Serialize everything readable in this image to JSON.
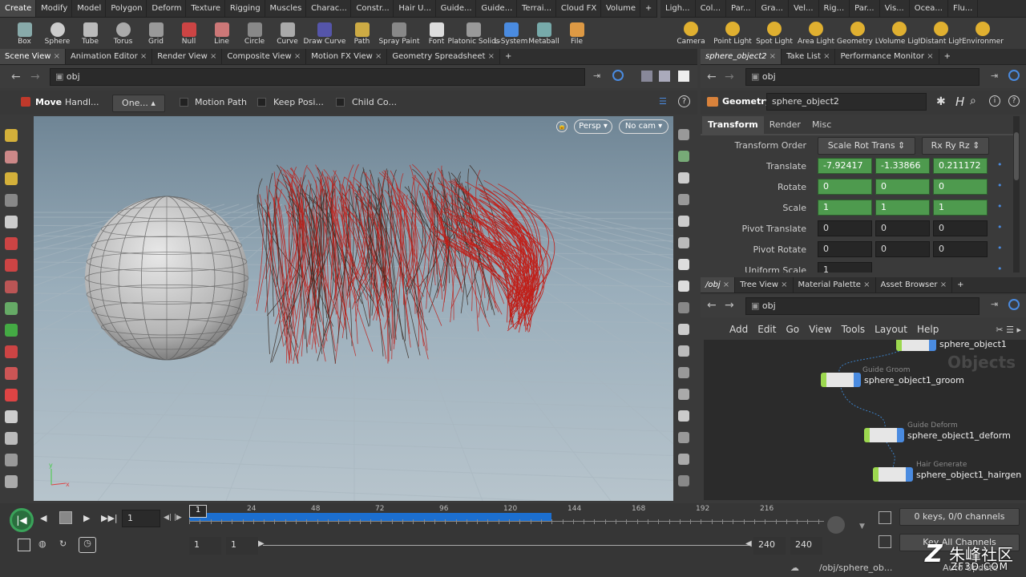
{
  "top_tabs": [
    "Create",
    "Modify",
    "Model",
    "Polygon",
    "Deform",
    "Texture",
    "Rigging",
    "Muscles",
    "Charac...",
    "Constr...",
    "Hair U...",
    "Guide...",
    "Guide...",
    "Terrai...",
    "Cloud FX",
    "Volume"
  ],
  "top_tabs_right": [
    "Ligh...",
    "Col...",
    "Par...",
    "Gra...",
    "Vel...",
    "Rig...",
    "Par...",
    "Vis...",
    "Ocea...",
    "Flu..."
  ],
  "shelf_tools": [
    "Box",
    "Sphere",
    "Tube",
    "Torus",
    "Grid",
    "Null",
    "Line",
    "Circle",
    "Curve",
    "Draw Curve",
    "Path",
    "Spray Paint",
    "Font",
    "Platonic Solids",
    "L-System",
    "Metaball",
    "File"
  ],
  "light_tools": [
    "Camera",
    "Point Light",
    "Spot Light",
    "Area Light",
    "Geometry Light",
    "Volume Light",
    "Distant Light",
    "Environment Light"
  ],
  "pane_tabs": [
    "Scene View",
    "Animation Editor",
    "Render View",
    "Composite View",
    "Motion FX View",
    "Geometry Spreadsheet"
  ],
  "right_pane_tabs": [
    "sphere_object2",
    "Take List",
    "Performance Monitor"
  ],
  "path": "obj",
  "toolbar": {
    "tool_name": "Move",
    "handle": "Handl...",
    "one": "One...",
    "motion_path": "Motion Path",
    "keep_pos": "Keep Posi...",
    "child_comp": "Child Co..."
  },
  "viewport": {
    "persp": "Persp",
    "cam": "No cam"
  },
  "params": {
    "type": "Geometry",
    "name": "sphere_object2",
    "tabs": [
      "Transform",
      "Render",
      "Misc"
    ],
    "transform_order": [
      "Scale Rot Trans",
      "Rx Ry Rz"
    ],
    "rows": [
      {
        "label": "Translate",
        "values": [
          "-7.92417",
          "-1.33866",
          "0.211172"
        ],
        "green": true
      },
      {
        "label": "Rotate",
        "values": [
          "0",
          "0",
          "0"
        ],
        "green": true
      },
      {
        "label": "Scale",
        "values": [
          "1",
          "1",
          "1"
        ],
        "green": true
      },
      {
        "label": "Pivot Translate",
        "values": [
          "0",
          "0",
          "0"
        ],
        "green": false
      },
      {
        "label": "Pivot Rotate",
        "values": [
          "0",
          "0",
          "0"
        ],
        "green": false
      },
      {
        "label": "Uniform Scale",
        "values": [
          "1"
        ],
        "green": false
      }
    ],
    "transform_order_label": "Transform Order"
  },
  "network_tabs": [
    "/obj",
    "Tree View",
    "Material Palette",
    "Asset Browser"
  ],
  "network_menu": [
    "Add",
    "Edit",
    "Go",
    "View",
    "Tools",
    "Layout",
    "Help"
  ],
  "network_watermark": "Objects",
  "nodes": [
    {
      "name": "sphere_object1",
      "type": ""
    },
    {
      "name": "sphere_object1_groom",
      "type": "Guide Groom"
    },
    {
      "name": "sphere_object1_deform",
      "type": "Guide Deform"
    },
    {
      "name": "sphere_object1_hairgen",
      "type": "Hair Generate"
    }
  ],
  "timeline": {
    "frame": "1",
    "ticks": [
      "24",
      "48",
      "72",
      "96",
      "120",
      "144",
      "168",
      "192",
      "216"
    ],
    "start": "1",
    "start2": "1",
    "end": "240",
    "end2": "240",
    "current_marker": "1"
  },
  "channels": {
    "keys": "0 keys, 0/0 channels",
    "key_all": "Key All Channels",
    "auto_update": "Auto Update"
  },
  "status_path": "/obj/sphere_ob...",
  "watermark": {
    "text": "朱峰社区",
    "url": "ZF3D.COM"
  },
  "colors": {
    "accent_green": "#4e9a4e",
    "timeline_blue": "#1c6fd0",
    "hair_red": "#c0201a"
  }
}
